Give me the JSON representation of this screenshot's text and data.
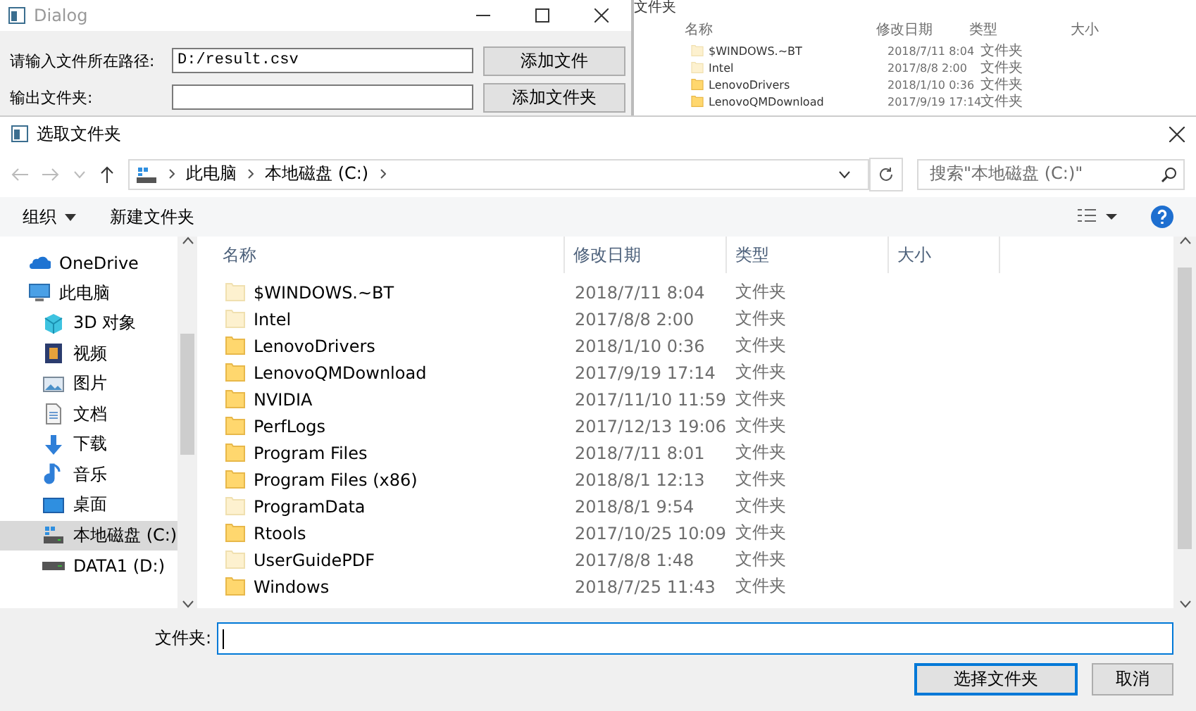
{
  "background_dialog": {
    "title": "Dialog",
    "fields": [
      {
        "label": "请输入文件所在路径:",
        "value": "D:/result.csv",
        "button": "添加文件"
      },
      {
        "label": "输出文件夹:",
        "button": "添加文件夹"
      }
    ]
  },
  "background_explorer": {
    "title": "文件夹",
    "columns": [
      "名称",
      "修改日期",
      "类型",
      "大小"
    ],
    "rows": [
      {
        "name": "$WINDOWS.~BT",
        "date": "2018/7/11 8:04",
        "type": "文件夹",
        "hidden": true
      },
      {
        "name": "Intel",
        "date": "2017/8/8 2:00",
        "type": "文件夹",
        "hidden": true
      },
      {
        "name": "LenovoDrivers",
        "date": "2018/1/10 0:36",
        "type": "文件夹",
        "hidden": false
      },
      {
        "name": "LenovoQMDownload",
        "date": "2017/9/19 17:14",
        "type": "文件夹",
        "hidden": false
      }
    ]
  },
  "dialog": {
    "title": "选取文件夹",
    "breadcrumb": [
      "此电脑",
      "本地磁盘 (C:)"
    ],
    "search": {
      "placeholder": "搜索\"本地磁盘 (C:)\""
    },
    "toolbar": {
      "organize": "组织",
      "new_folder": "新建文件夹"
    },
    "sidebar": {
      "items": [
        {
          "label": "OneDrive",
          "selected": false
        },
        {
          "label": "此电脑",
          "selected": false,
          "children": [
            {
              "label": "3D 对象",
              "selected": false
            },
            {
              "label": "视频",
              "selected": false
            },
            {
              "label": "图片",
              "selected": false
            },
            {
              "label": "文档",
              "selected": false
            },
            {
              "label": "下载",
              "selected": false
            },
            {
              "label": "音乐",
              "selected": false
            },
            {
              "label": "桌面",
              "selected": false
            },
            {
              "label": "本地磁盘 (C:)",
              "selected": true
            },
            {
              "label": "DATA1 (D:)",
              "selected": false
            }
          ]
        }
      ]
    },
    "table": {
      "columns": [
        "名称",
        "修改日期",
        "类型",
        "大小"
      ],
      "rows": [
        {
          "name": "$WINDOWS.~BT",
          "date": "2018/7/11 8:04",
          "type": "文件夹",
          "hidden": true
        },
        {
          "name": "Intel",
          "date": "2017/8/8 2:00",
          "type": "文件夹",
          "hidden": true
        },
        {
          "name": "LenovoDrivers",
          "date": "2018/1/10 0:36",
          "type": "文件夹",
          "hidden": false
        },
        {
          "name": "LenovoQMDownload",
          "date": "2017/9/19 17:14",
          "type": "文件夹",
          "hidden": false
        },
        {
          "name": "NVIDIA",
          "date": "2017/11/10 11:59",
          "type": "文件夹",
          "hidden": false
        },
        {
          "name": "PerfLogs",
          "date": "2017/12/13 19:06",
          "type": "文件夹",
          "hidden": false
        },
        {
          "name": "Program Files",
          "date": "2018/7/11 8:01",
          "type": "文件夹",
          "hidden": false
        },
        {
          "name": "Program Files (x86)",
          "date": "2018/8/1 12:13",
          "type": "文件夹",
          "hidden": false
        },
        {
          "name": "ProgramData",
          "date": "2018/8/1 9:54",
          "type": "文件夹",
          "hidden": true
        },
        {
          "name": "Rtools",
          "date": "2017/10/25 10:09",
          "type": "文件夹",
          "hidden": false
        },
        {
          "name": "UserGuidePDF",
          "date": "2017/8/8 1:48",
          "type": "文件夹",
          "hidden": true
        },
        {
          "name": "Windows",
          "date": "2018/7/25 11:43",
          "type": "文件夹",
          "hidden": false
        }
      ]
    },
    "folder_field": {
      "label": "文件夹:"
    },
    "buttons": [
      {
        "label": "选择文件夹",
        "default": true
      },
      {
        "label": "取消",
        "default": false
      }
    ]
  }
}
